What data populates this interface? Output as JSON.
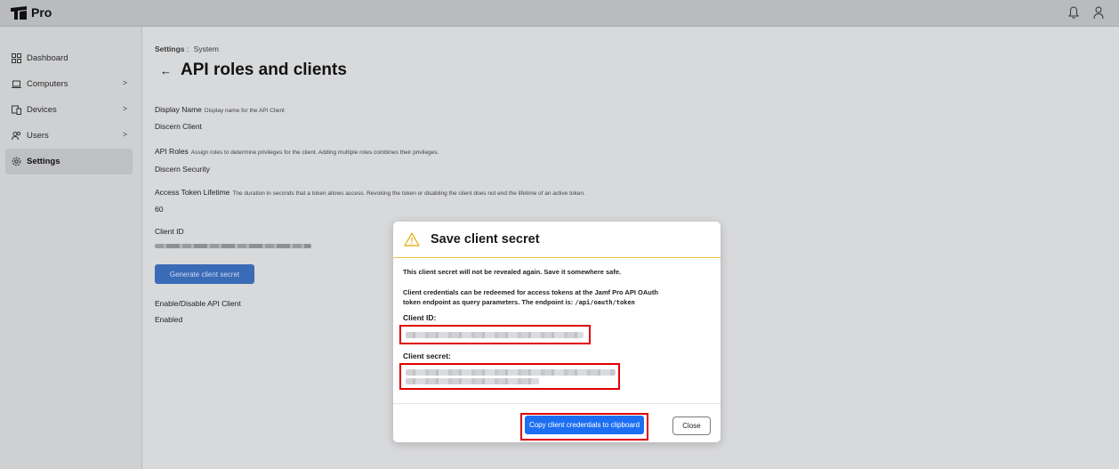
{
  "app": {
    "name": "Pro"
  },
  "sidebar": {
    "items": [
      {
        "label": "Dashboard",
        "icon": "grid-icon",
        "chevron": ""
      },
      {
        "label": "Computers",
        "icon": "laptop-icon",
        "chevron": ">"
      },
      {
        "label": "Devices",
        "icon": "devices-icon",
        "chevron": ">"
      },
      {
        "label": "Users",
        "icon": "users-icon",
        "chevron": ">"
      },
      {
        "label": "Settings",
        "icon": "gear-icon",
        "chevron": "",
        "active": true
      }
    ]
  },
  "header": {
    "breadcrumb_parent": "Settings",
    "breadcrumb_sep": ":",
    "breadcrumb_child": "System",
    "back": "←",
    "title": "API roles and clients"
  },
  "form": {
    "display_name_label": "Display Name",
    "display_name_hint": "Display name for the API Client",
    "display_name_value": "Discern Client",
    "api_roles_label": "API Roles",
    "api_roles_hint": "Assign roles to determine privileges for the client. Adding multiple roles combines their privileges.",
    "api_roles_value": "Discern Security",
    "token_lifetime_label": "Access Token Lifetime",
    "token_lifetime_hint": "The duration in seconds that a token allows access. Revoking the token or disabling the client does not end the lifetime of an active token.",
    "token_lifetime_value": "60",
    "client_id_label": "Client ID",
    "generate_button": "Generate client secret",
    "enable_label": "Enable/Disable API Client",
    "enable_value": "Enabled"
  },
  "modal": {
    "title": "Save client secret",
    "warning": "This client secret will not be revealed again. Save it somewhere safe.",
    "info_line1": "Client credentials can be redeemed for access tokens at the Jamf Pro API OAuth",
    "info_line2": "token endpoint as query parameters. The endpoint is:",
    "endpoint": "/api/oauth/token",
    "client_id_label": "Client ID:",
    "client_secret_label": "Client secret:",
    "copy_button": "Copy client credentials to clipboard",
    "close_button": "Close"
  },
  "colors": {
    "accent": "#1d6ff2",
    "highlight": "#e00000",
    "warning": "#f0c040"
  }
}
